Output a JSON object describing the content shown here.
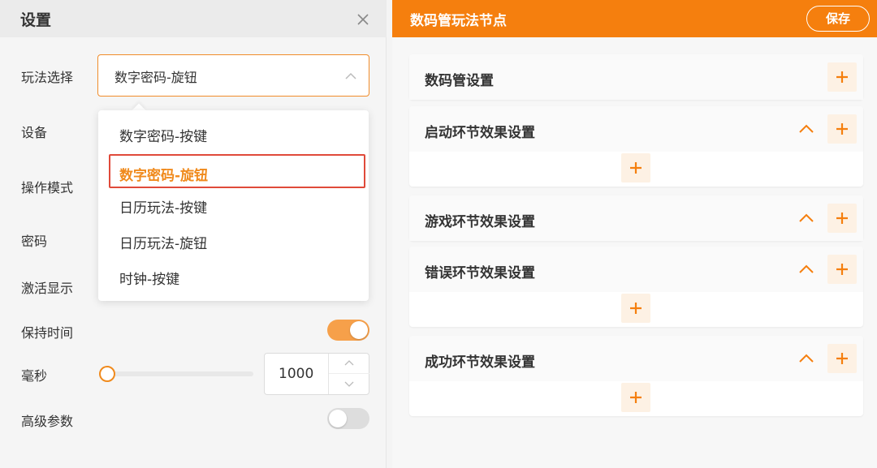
{
  "left_panel": {
    "title": "设置",
    "rows": {
      "mode_select": "玩法选择",
      "device": "设备",
      "operation_mode": "操作模式",
      "password": "密码",
      "activation_display": "激活显示",
      "hold_time": "保持时间",
      "milliseconds": "毫秒",
      "advanced_params": "高级参数"
    },
    "select": {
      "value": "数字密码-旋钮",
      "options": [
        "数字密码-按键",
        "数字密码-旋钮",
        "日历玩法-按键",
        "日历玩法-旋钮",
        "时钟-按键"
      ],
      "selected_index": 1
    },
    "hold_time_toggle": true,
    "advanced_toggle": false,
    "ms_slider_value": 0,
    "ms_value": "1000"
  },
  "right_panel": {
    "title": "数码管玩法节点",
    "save_label": "保存",
    "sections": [
      {
        "title": "数码管设置",
        "collapsible": false
      },
      {
        "title": "启动环节效果设置",
        "collapsible": true
      },
      {
        "title": "游戏环节效果设置",
        "collapsible": true
      },
      {
        "title": "错误环节效果设置",
        "collapsible": true
      },
      {
        "title": "成功环节效果设置",
        "collapsible": true
      }
    ]
  },
  "colors": {
    "accent": "#f57f0e",
    "accent_light": "#fdf1e4",
    "selected_text": "#f08a1c",
    "highlight_border": "#e04a3a"
  },
  "icons": [
    "close-icon",
    "chevron-up-icon",
    "chevron-down-icon",
    "plus-icon"
  ]
}
